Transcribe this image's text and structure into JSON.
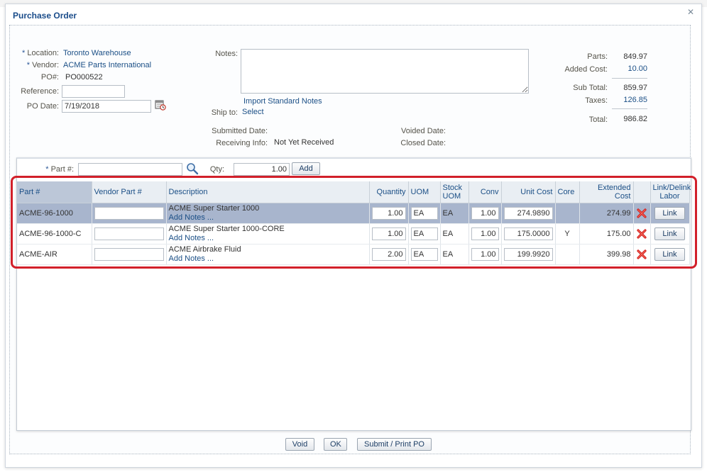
{
  "dialog": {
    "title": "Purchase Order"
  },
  "form": {
    "location_label": "Location:",
    "location_value": "Toronto Warehouse",
    "vendor_label": "Vendor:",
    "vendor_value": "ACME Parts International",
    "po_label": "PO#:",
    "po_value": "PO000522",
    "reference_label": "Reference:",
    "reference_value": "",
    "po_date_label": "PO Date:",
    "po_date_value": "7/19/2018",
    "notes_label": "Notes:",
    "notes_value": "",
    "import_notes_link": "Import Standard Notes",
    "ship_to_label": "Ship to:",
    "ship_to_link": "Select",
    "submitted_date_label": "Submitted Date:",
    "receiving_info_label": "Receiving Info:",
    "receiving_info_value": "Not Yet Received",
    "voided_date_label": "Voided Date:",
    "closed_date_label": "Closed Date:"
  },
  "totals": {
    "parts_label": "Parts:",
    "parts_value": "849.97",
    "added_cost_label": "Added Cost:",
    "added_cost_value": "10.00",
    "sub_total_label": "Sub Total:",
    "sub_total_value": "859.97",
    "taxes_label": "Taxes:",
    "taxes_value": "126.85",
    "total_label": "Total:",
    "total_value": "986.82"
  },
  "add_part": {
    "part_label": "Part #:",
    "part_value": "",
    "qty_label": "Qty:",
    "qty_value": "1.00",
    "add_button": "Add"
  },
  "grid": {
    "columns": {
      "part": "Part #",
      "vendor_part": "Vendor Part #",
      "description": "Description",
      "quantity": "Quantity",
      "uom": "UOM",
      "stock_uom_1": "Stock",
      "stock_uom_2": "UOM",
      "conv": "Conv",
      "unit_cost": "Unit Cost",
      "core": "Core",
      "extended_cost": "Extended Cost",
      "link_1": "Link/Delink",
      "link_2": "Labor"
    },
    "rows": [
      {
        "part": "ACME-96-1000",
        "vendor_part": "",
        "description": "ACME Super Starter 1000",
        "add_notes": "Add Notes ...",
        "quantity": "1.00",
        "uom": "EA",
        "stock_uom": "EA",
        "conv": "1.00",
        "unit_cost": "274.9890",
        "core": "",
        "extended_cost": "274.99",
        "link": "Link"
      },
      {
        "part": "ACME-96-1000-C",
        "vendor_part": "",
        "description": "ACME Super Starter 1000-CORE",
        "add_notes": "Add Notes ...",
        "quantity": "1.00",
        "uom": "EA",
        "stock_uom": "EA",
        "conv": "1.00",
        "unit_cost": "175.0000",
        "core": "Y",
        "extended_cost": "175.00",
        "link": "Link"
      },
      {
        "part": "ACME-AIR",
        "vendor_part": "",
        "description": "ACME Airbrake Fluid",
        "add_notes": "Add Notes ...",
        "quantity": "2.00",
        "uom": "EA",
        "stock_uom": "EA",
        "conv": "1.00",
        "unit_cost": "199.9920",
        "core": "",
        "extended_cost": "399.98",
        "link": "Link"
      }
    ]
  },
  "footer": {
    "void_button": "Void",
    "ok_button": "OK",
    "submit_button": "Submit / Print PO"
  },
  "colors": {
    "accent_blue": "#1b4f86",
    "highlight_red": "#d2202a",
    "selected_row": "#a8b5cd"
  },
  "icons": [
    "search-icon",
    "calendar-icon",
    "delete-icon",
    "close-icon"
  ]
}
